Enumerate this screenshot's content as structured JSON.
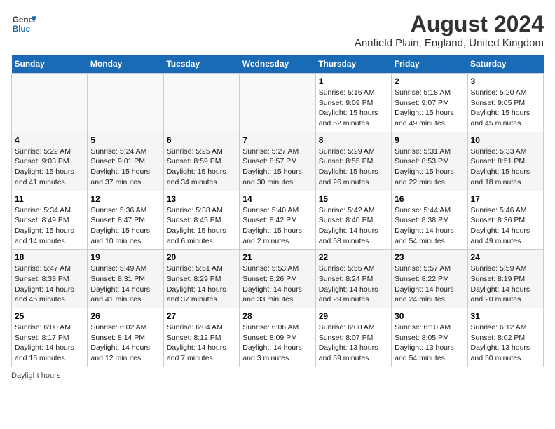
{
  "logo": {
    "line1": "General",
    "line2": "Blue"
  },
  "title": "August 2024",
  "subtitle": "Annfield Plain, England, United Kingdom",
  "footer": "Daylight hours",
  "headers": [
    "Sunday",
    "Monday",
    "Tuesday",
    "Wednesday",
    "Thursday",
    "Friday",
    "Saturday"
  ],
  "weeks": [
    [
      {
        "day": "",
        "sunrise": "",
        "sunset": "",
        "daylight": ""
      },
      {
        "day": "",
        "sunrise": "",
        "sunset": "",
        "daylight": ""
      },
      {
        "day": "",
        "sunrise": "",
        "sunset": "",
        "daylight": ""
      },
      {
        "day": "",
        "sunrise": "",
        "sunset": "",
        "daylight": ""
      },
      {
        "day": "1",
        "sunrise": "5:16 AM",
        "sunset": "9:09 PM",
        "daylight": "15 hours and 52 minutes."
      },
      {
        "day": "2",
        "sunrise": "5:18 AM",
        "sunset": "9:07 PM",
        "daylight": "15 hours and 49 minutes."
      },
      {
        "day": "3",
        "sunrise": "5:20 AM",
        "sunset": "9:05 PM",
        "daylight": "15 hours and 45 minutes."
      }
    ],
    [
      {
        "day": "4",
        "sunrise": "5:22 AM",
        "sunset": "9:03 PM",
        "daylight": "15 hours and 41 minutes."
      },
      {
        "day": "5",
        "sunrise": "5:24 AM",
        "sunset": "9:01 PM",
        "daylight": "15 hours and 37 minutes."
      },
      {
        "day": "6",
        "sunrise": "5:25 AM",
        "sunset": "8:59 PM",
        "daylight": "15 hours and 34 minutes."
      },
      {
        "day": "7",
        "sunrise": "5:27 AM",
        "sunset": "8:57 PM",
        "daylight": "15 hours and 30 minutes."
      },
      {
        "day": "8",
        "sunrise": "5:29 AM",
        "sunset": "8:55 PM",
        "daylight": "15 hours and 26 minutes."
      },
      {
        "day": "9",
        "sunrise": "5:31 AM",
        "sunset": "8:53 PM",
        "daylight": "15 hours and 22 minutes."
      },
      {
        "day": "10",
        "sunrise": "5:33 AM",
        "sunset": "8:51 PM",
        "daylight": "15 hours and 18 minutes."
      }
    ],
    [
      {
        "day": "11",
        "sunrise": "5:34 AM",
        "sunset": "8:49 PM",
        "daylight": "15 hours and 14 minutes."
      },
      {
        "day": "12",
        "sunrise": "5:36 AM",
        "sunset": "8:47 PM",
        "daylight": "15 hours and 10 minutes."
      },
      {
        "day": "13",
        "sunrise": "5:38 AM",
        "sunset": "8:45 PM",
        "daylight": "15 hours and 6 minutes."
      },
      {
        "day": "14",
        "sunrise": "5:40 AM",
        "sunset": "8:42 PM",
        "daylight": "15 hours and 2 minutes."
      },
      {
        "day": "15",
        "sunrise": "5:42 AM",
        "sunset": "8:40 PM",
        "daylight": "14 hours and 58 minutes."
      },
      {
        "day": "16",
        "sunrise": "5:44 AM",
        "sunset": "8:38 PM",
        "daylight": "14 hours and 54 minutes."
      },
      {
        "day": "17",
        "sunrise": "5:46 AM",
        "sunset": "8:36 PM",
        "daylight": "14 hours and 49 minutes."
      }
    ],
    [
      {
        "day": "18",
        "sunrise": "5:47 AM",
        "sunset": "8:33 PM",
        "daylight": "14 hours and 45 minutes."
      },
      {
        "day": "19",
        "sunrise": "5:49 AM",
        "sunset": "8:31 PM",
        "daylight": "14 hours and 41 minutes."
      },
      {
        "day": "20",
        "sunrise": "5:51 AM",
        "sunset": "8:29 PM",
        "daylight": "14 hours and 37 minutes."
      },
      {
        "day": "21",
        "sunrise": "5:53 AM",
        "sunset": "8:26 PM",
        "daylight": "14 hours and 33 minutes."
      },
      {
        "day": "22",
        "sunrise": "5:55 AM",
        "sunset": "8:24 PM",
        "daylight": "14 hours and 29 minutes."
      },
      {
        "day": "23",
        "sunrise": "5:57 AM",
        "sunset": "8:22 PM",
        "daylight": "14 hours and 24 minutes."
      },
      {
        "day": "24",
        "sunrise": "5:59 AM",
        "sunset": "8:19 PM",
        "daylight": "14 hours and 20 minutes."
      }
    ],
    [
      {
        "day": "25",
        "sunrise": "6:00 AM",
        "sunset": "8:17 PM",
        "daylight": "14 hours and 16 minutes."
      },
      {
        "day": "26",
        "sunrise": "6:02 AM",
        "sunset": "8:14 PM",
        "daylight": "14 hours and 12 minutes."
      },
      {
        "day": "27",
        "sunrise": "6:04 AM",
        "sunset": "8:12 PM",
        "daylight": "14 hours and 7 minutes."
      },
      {
        "day": "28",
        "sunrise": "6:06 AM",
        "sunset": "8:09 PM",
        "daylight": "14 hours and 3 minutes."
      },
      {
        "day": "29",
        "sunrise": "6:08 AM",
        "sunset": "8:07 PM",
        "daylight": "13 hours and 59 minutes."
      },
      {
        "day": "30",
        "sunrise": "6:10 AM",
        "sunset": "8:05 PM",
        "daylight": "13 hours and 54 minutes."
      },
      {
        "day": "31",
        "sunrise": "6:12 AM",
        "sunset": "8:02 PM",
        "daylight": "13 hours and 50 minutes."
      }
    ]
  ]
}
